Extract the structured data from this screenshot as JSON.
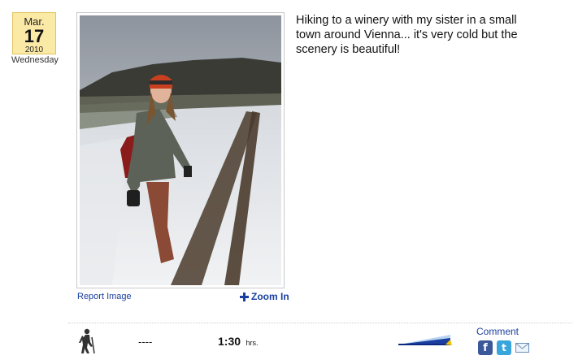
{
  "entry": {
    "date": {
      "month": "Mar.",
      "day": "17",
      "year": "2010",
      "weekday": "Wednesday"
    },
    "caption": "Hiking to a winery with my sister in a small town around Vienna... it's very cold but the scenery is beautiful!",
    "photo": {
      "alt": "Photo"
    },
    "links": {
      "report": "Report Image",
      "zoom": "Zoom In"
    }
  },
  "stats": {
    "activity_icon": "hiker-icon",
    "distance": "----",
    "duration_value": "1:30",
    "duration_unit": "hrs.",
    "difficulty_icon": "difficulty-meter-icon"
  },
  "social": {
    "comment": "Comment",
    "facebook_letter": "f",
    "twitter_letter": "t",
    "icons": [
      "facebook-icon",
      "twitter-icon",
      "email-icon"
    ]
  },
  "colors": {
    "date_bg": "#fbe9a6",
    "link": "#1a3fa0",
    "facebook": "#3b5998",
    "twitter": "#38a6dc"
  }
}
